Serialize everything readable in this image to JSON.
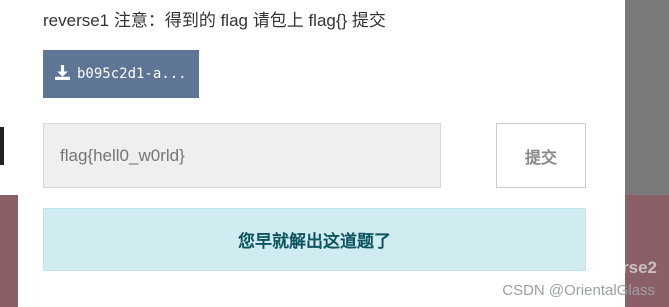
{
  "challenge": {
    "prompt": "reverse1 注意：得到的 flag 请包上 flag{} 提交",
    "file_button_label": "b095c2d1-a...",
    "file_icon": "download-icon"
  },
  "flag_input": {
    "placeholder": "flag{hell0_w0rld}",
    "value": ""
  },
  "submit_label": "提交",
  "solved_message": "您早就解出这道题了",
  "background": {
    "partial_text": "rse2"
  },
  "watermark": "CSDN @OrientalGlass",
  "colors": {
    "file_button_bg": "#5e7596",
    "banner_bg": "#d1ecf1",
    "banner_text": "#0c5460"
  }
}
